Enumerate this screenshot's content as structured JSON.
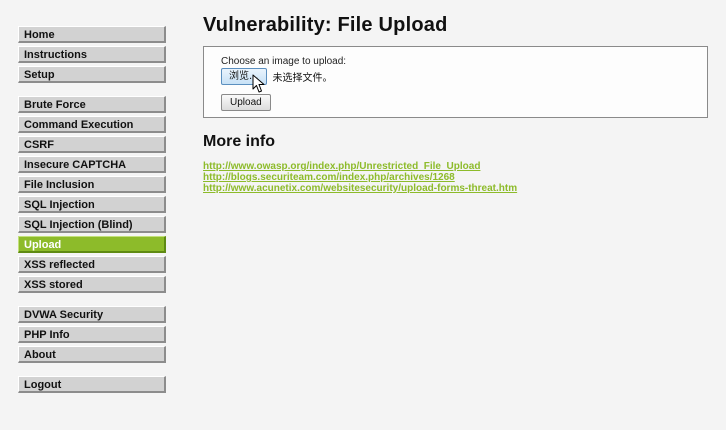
{
  "sidebar": {
    "group1": [
      "Home",
      "Instructions",
      "Setup"
    ],
    "group2": [
      "Brute Force",
      "Command Execution",
      "CSRF",
      "Insecure CAPTCHA",
      "File Inclusion",
      "SQL Injection",
      "SQL Injection (Blind)",
      "Upload",
      "XSS reflected",
      "XSS stored"
    ],
    "group3": [
      "DVWA Security",
      "PHP Info",
      "About"
    ],
    "group4": [
      "Logout"
    ],
    "active": "Upload"
  },
  "main": {
    "title": "Vulnerability: File Upload",
    "upload_form": {
      "label": "Choose an image to upload:",
      "browse_label": "浏览...",
      "file_status": "未选择文件。",
      "upload_label": "Upload"
    },
    "more_info_title": "More info",
    "links": [
      "http://www.owasp.org/index.php/Unrestricted_File_Upload",
      "http://blogs.securiteam.com/index.php/archives/1268",
      "http://www.acunetix.com/websitesecurity/upload-forms-threat.htm"
    ]
  },
  "colors": {
    "accent": "#8dbb2a",
    "nav_bg": "#d2d2d2",
    "page_bg": "#f4f4f4"
  },
  "icons": {
    "cursor": "mouse-pointer-icon"
  }
}
